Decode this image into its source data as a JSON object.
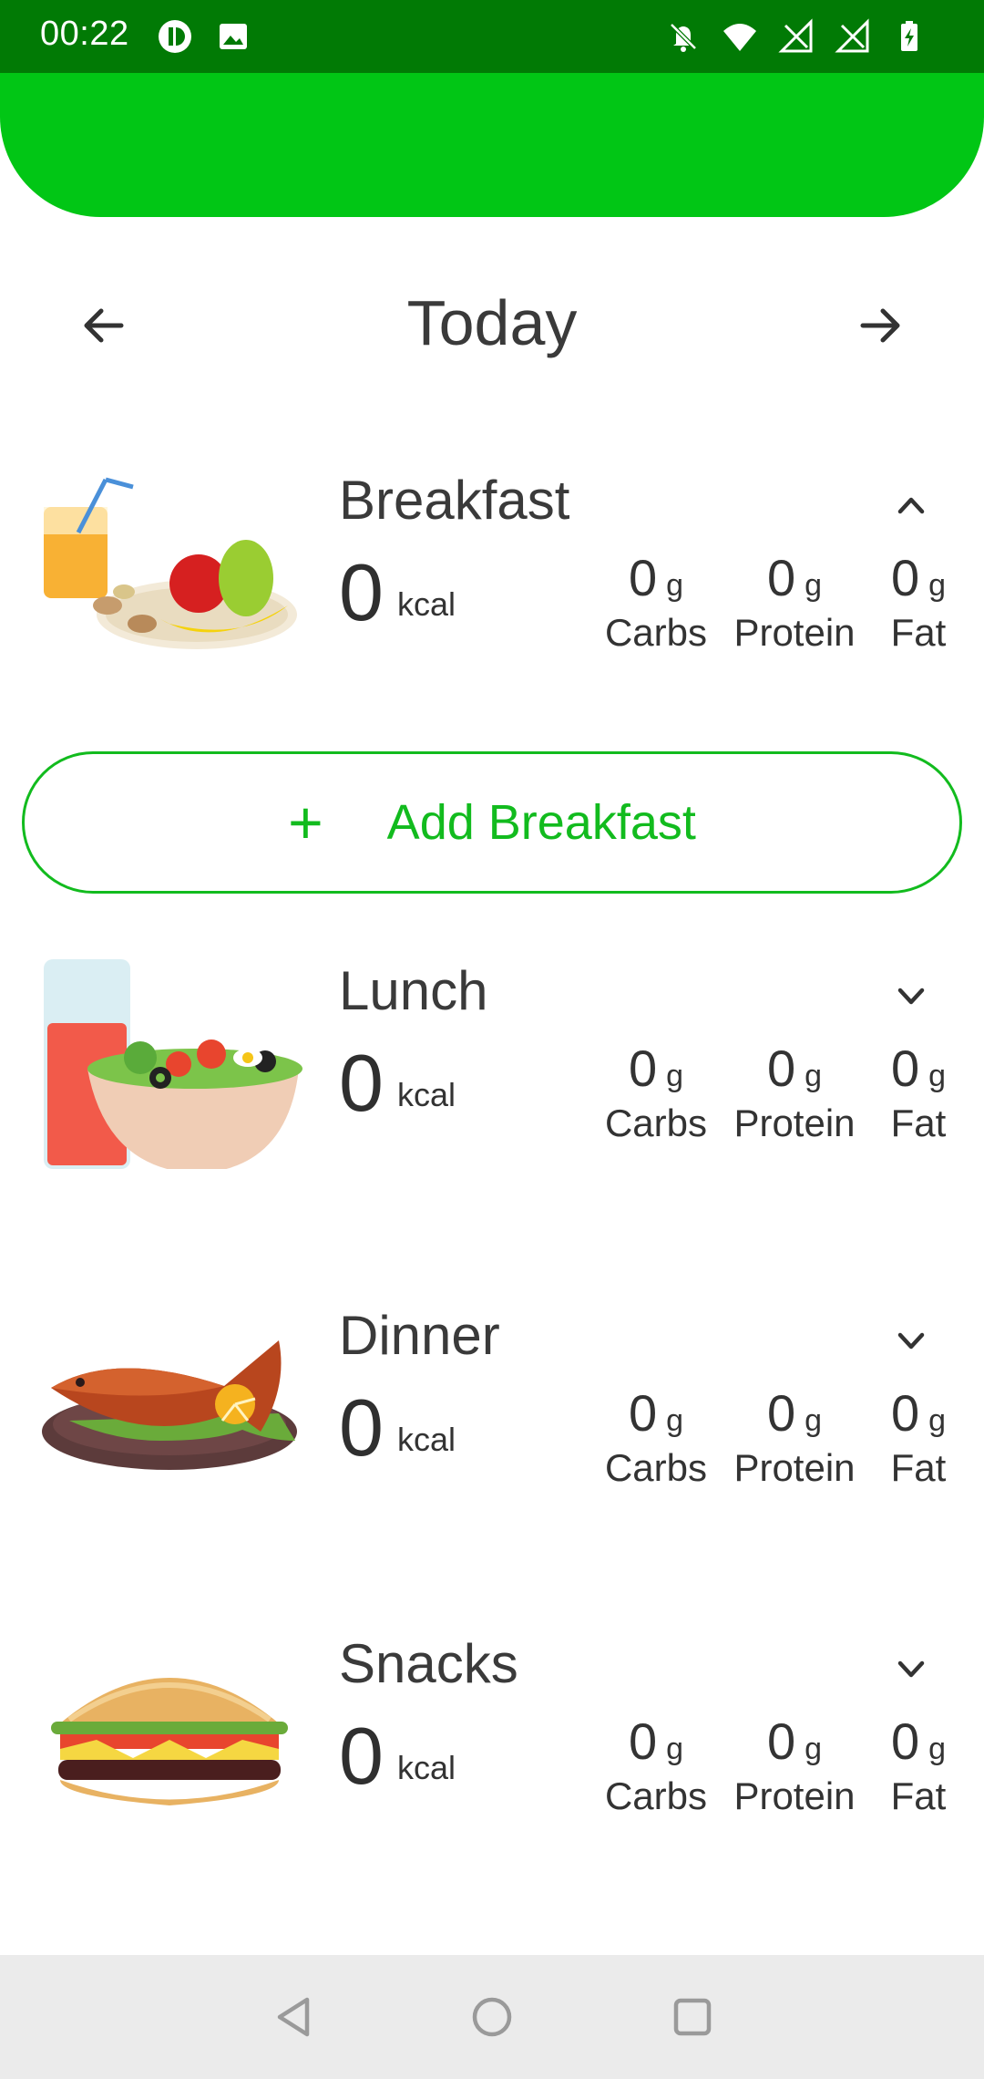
{
  "status_bar": {
    "time": "00:22",
    "left_icons": [
      "tracker-app-icon",
      "image-icon"
    ],
    "right_icons": [
      "bell-off-icon",
      "wifi-icon",
      "signal-icon",
      "signal-icon",
      "battery-charging-icon"
    ]
  },
  "colors": {
    "status_bar": "#017a05",
    "header": "#01c615",
    "accent": "#12bb1e",
    "nav_bar": "#ebebeb"
  },
  "date_nav": {
    "title": "Today",
    "prev_icon": "arrow-left-icon",
    "next_icon": "arrow-right-icon"
  },
  "meals": [
    {
      "name": "Breakfast",
      "expanded": true,
      "chevron_icon": "chevron-up-icon",
      "kcal": "0",
      "kcal_unit": "kcal",
      "carbs": "0",
      "protein": "0",
      "fat": "0",
      "unit": "g",
      "carbs_label": "Carbs",
      "protein_label": "Protein",
      "fat_label": "Fat",
      "illustration": "breakfast-illustration"
    },
    {
      "name": "Lunch",
      "expanded": false,
      "chevron_icon": "chevron-down-icon",
      "kcal": "0",
      "kcal_unit": "kcal",
      "carbs": "0",
      "protein": "0",
      "fat": "0",
      "unit": "g",
      "carbs_label": "Carbs",
      "protein_label": "Protein",
      "fat_label": "Fat",
      "illustration": "lunch-illustration"
    },
    {
      "name": "Dinner",
      "expanded": false,
      "chevron_icon": "chevron-down-icon",
      "kcal": "0",
      "kcal_unit": "kcal",
      "carbs": "0",
      "protein": "0",
      "fat": "0",
      "unit": "g",
      "carbs_label": "Carbs",
      "protein_label": "Protein",
      "fat_label": "Fat",
      "illustration": "dinner-illustration"
    },
    {
      "name": "Snacks",
      "expanded": false,
      "chevron_icon": "chevron-down-icon",
      "kcal": "0",
      "kcal_unit": "kcal",
      "carbs": "0",
      "protein": "0",
      "fat": "0",
      "unit": "g",
      "carbs_label": "Carbs",
      "protein_label": "Protein",
      "fat_label": "Fat",
      "illustration": "snacks-illustration"
    }
  ],
  "add_button": {
    "plus": "+",
    "label": "Add Breakfast"
  },
  "nav_bar": {
    "back_icon": "back-triangle-icon",
    "home_icon": "home-circle-icon",
    "recents_icon": "recents-square-icon"
  }
}
